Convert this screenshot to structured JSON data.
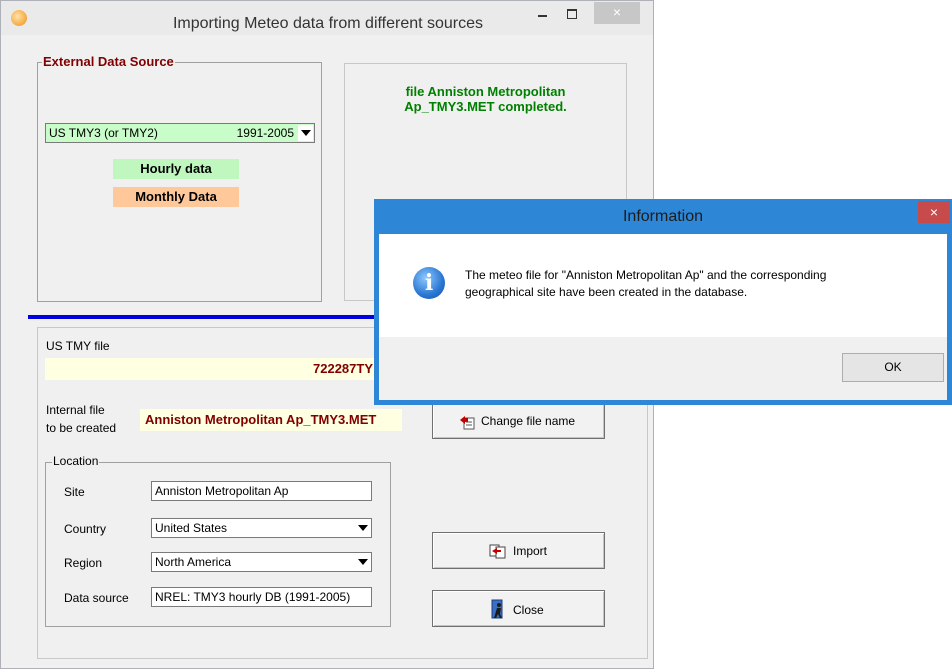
{
  "window": {
    "title": "Importing Meteo data from different sources",
    "close_glyph": "×"
  },
  "external_source": {
    "legend": "External Data Source",
    "source_label": "US TMY3 (or TMY2)",
    "source_years": "1991-2005",
    "hourly_label": "Hourly data",
    "monthly_label": "Monthly Data",
    "colors": {
      "hourly": "#bff7bf",
      "monthly": "#ffc89b",
      "source": "#c8fcc8"
    }
  },
  "status": {
    "line1": "file Anniston Metropolitan",
    "line2": "Ap_TMY3.MET  completed."
  },
  "file_section": {
    "us_tmy_label": "US TMY file",
    "us_tmy_value": "722287TY",
    "internal_label_line1": "Internal file",
    "internal_label_line2": "to be created",
    "internal_value": "Anniston Metropolitan Ap_TMY3.MET",
    "change_name_label": "Change file name"
  },
  "location": {
    "legend": "Location",
    "site_label": "Site",
    "site_value": "Anniston Metropolitan Ap",
    "country_label": "Country",
    "country_value": "United States",
    "region_label": "Region",
    "region_value": "North America",
    "data_source_label": "Data source",
    "data_source_value": "NREL: TMY3 hourly DB (1991-2005)"
  },
  "actions": {
    "import_label": "Import",
    "close_label": "Close"
  },
  "dialog": {
    "title": "Information",
    "close_glyph": "×",
    "message_line1": "The meteo file for \"Anniston Metropolitan Ap\" and the corresponding",
    "message_line2": "geographical site have been created in the database.",
    "ok_label": "OK",
    "icon_glyph": "i"
  }
}
